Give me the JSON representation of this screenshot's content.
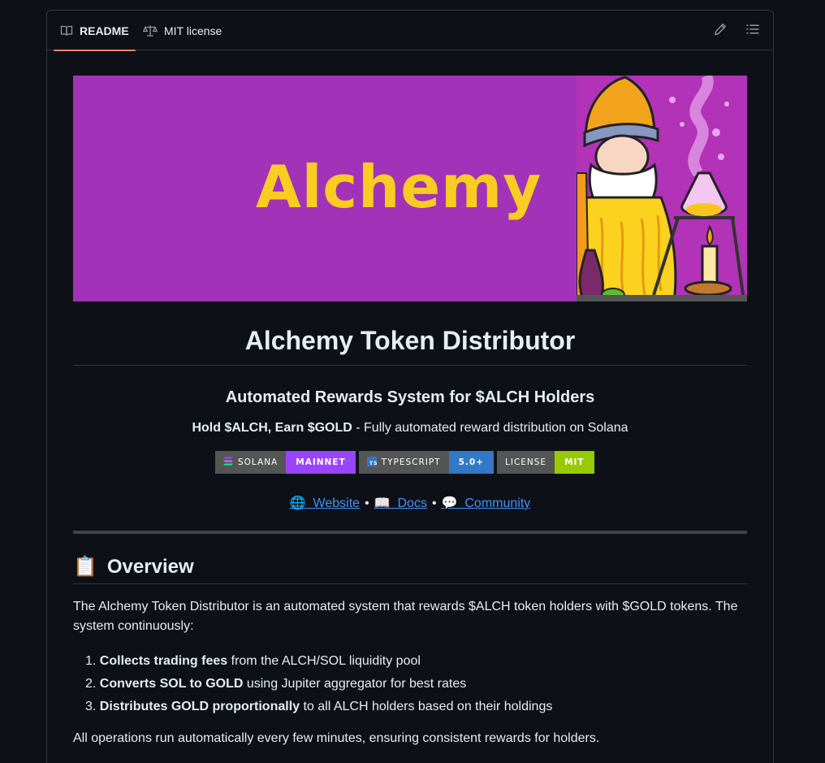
{
  "tabs": [
    {
      "label": "README",
      "icon": "book-icon",
      "active": true
    },
    {
      "label": "MIT license",
      "icon": "scale-icon",
      "active": false
    }
  ],
  "toolbar": {
    "edit_icon": "pencil-icon",
    "toc_icon": "list-icon"
  },
  "banner": {
    "title": "Alchemy",
    "background": "#a233b8",
    "title_color": "#f9cc22"
  },
  "heading": "Alchemy Token Distributor",
  "subheading": "Automated Rewards System for $ALCH Holders",
  "tagline": {
    "bold": "Hold $ALCH, Earn $GOLD",
    "rest": " - Fully automated reward distribution on Solana"
  },
  "badges": [
    {
      "label": "SOLANA",
      "value": "MAINNET",
      "color": "#9945ff",
      "icon": "solana-icon"
    },
    {
      "label": "TYPESCRIPT",
      "value": "5.0+",
      "color": "#3178c6",
      "icon": "typescript-icon"
    },
    {
      "label": "LICENSE",
      "value": "MIT",
      "color": "#97ca00",
      "icon": ""
    }
  ],
  "links": [
    {
      "emoji": "🌐",
      "label": "Website"
    },
    {
      "emoji": "📖",
      "label": "Docs"
    },
    {
      "emoji": "💬",
      "label": "Community"
    }
  ],
  "link_separator": "•",
  "overview": {
    "emoji": "📋",
    "title": "Overview",
    "intro": "The Alchemy Token Distributor is an automated system that rewards $ALCH token holders with $GOLD tokens. The system continuously:",
    "steps": [
      {
        "num": "1.",
        "bold": "Collects trading fees",
        "rest": " from the ALCH/SOL liquidity pool"
      },
      {
        "num": "2.",
        "bold": "Converts SOL to GOLD",
        "rest": " using Jupiter aggregator for best rates"
      },
      {
        "num": "3.",
        "bold": "Distributes GOLD proportionally",
        "rest": " to all ALCH holders based on their holdings"
      }
    ],
    "outro": "All operations run automatically every few minutes, ensuring consistent rewards for holders."
  }
}
